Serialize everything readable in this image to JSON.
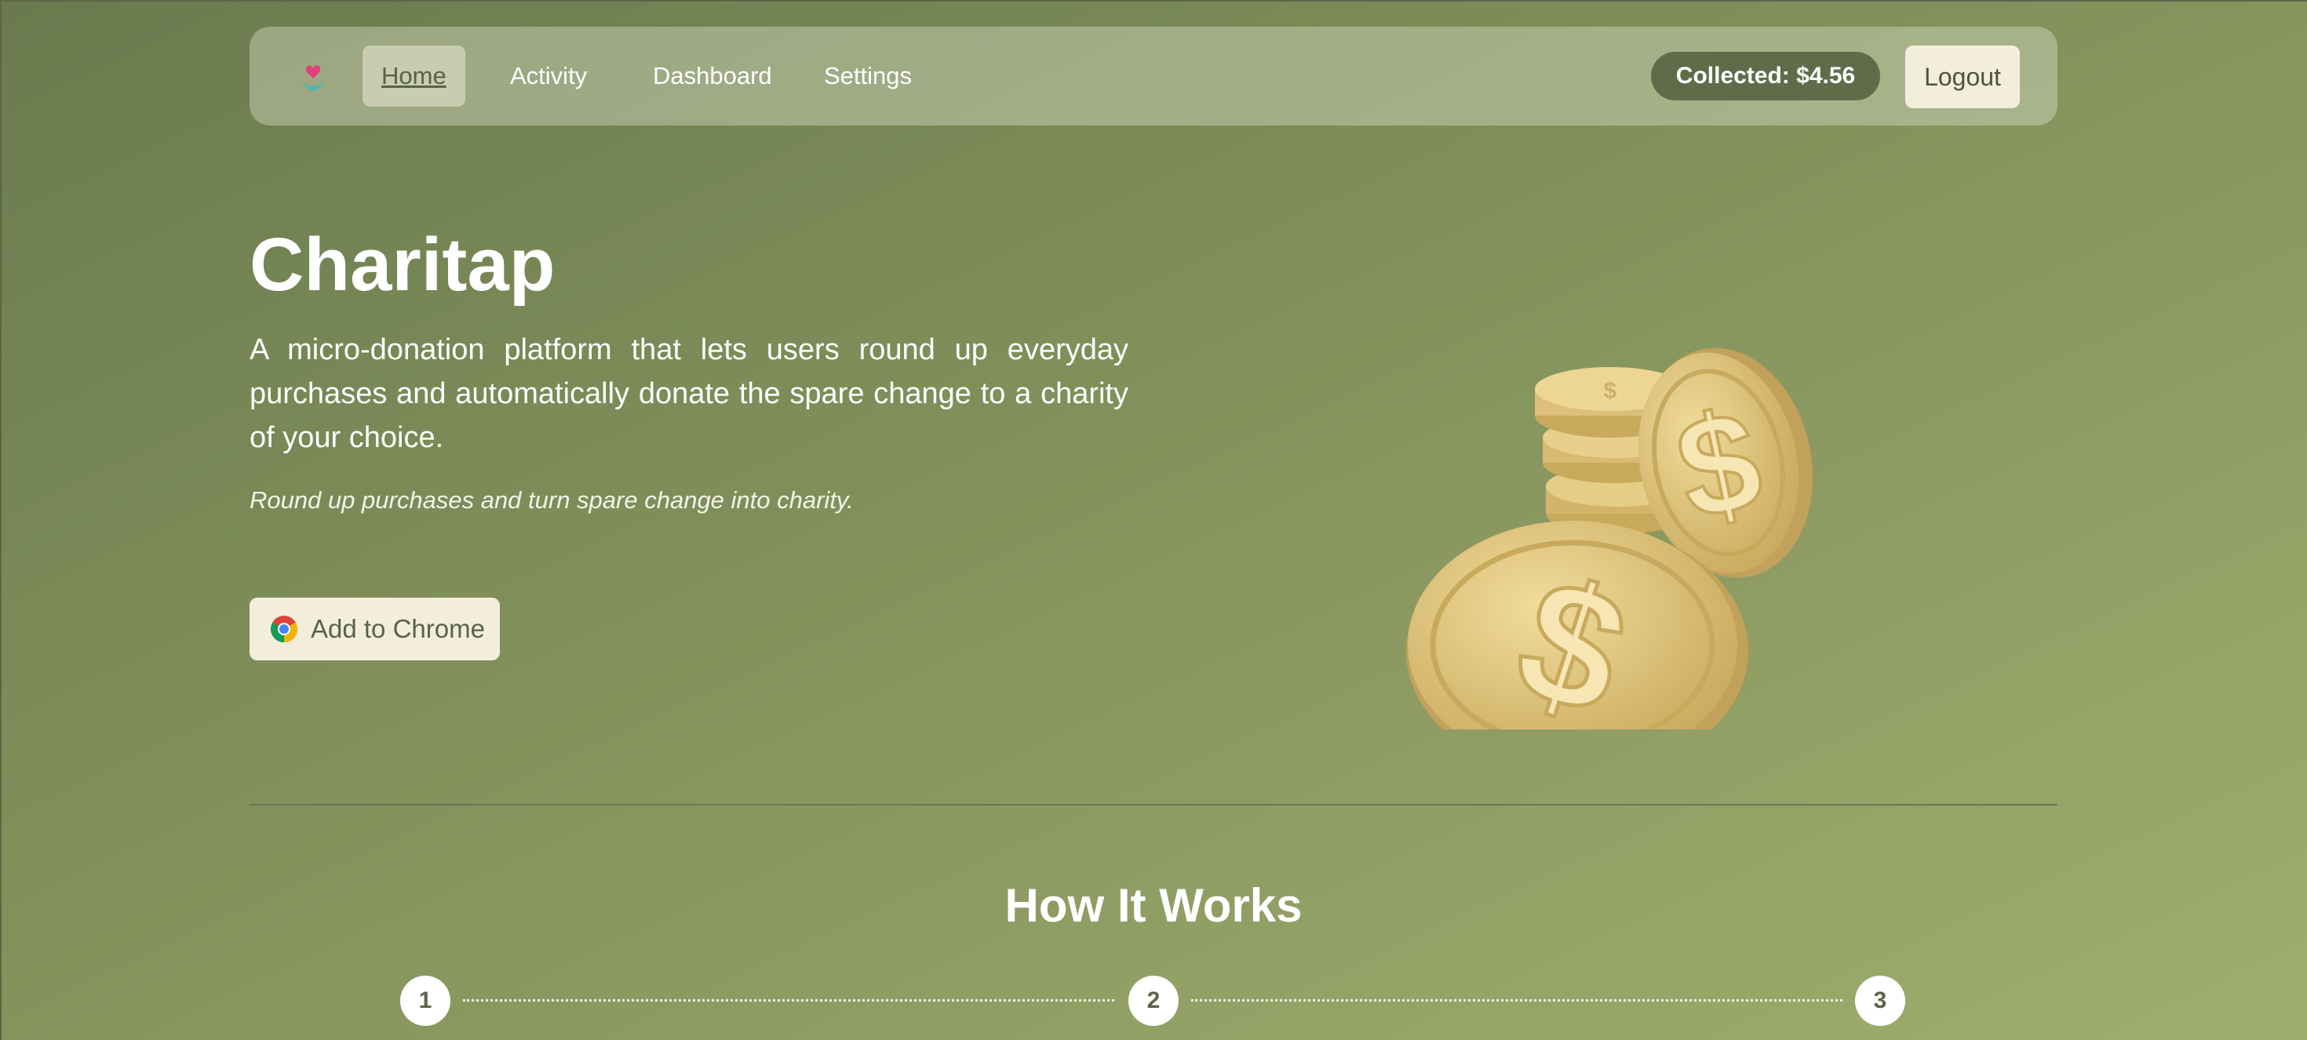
{
  "nav": {
    "logo_icon": "heart-hands-icon",
    "links": [
      {
        "label": "Home",
        "active": true
      },
      {
        "label": "Activity",
        "active": false
      },
      {
        "label": "Dashboard",
        "active": false
      },
      {
        "label": "Settings",
        "active": false
      }
    ],
    "collected_label": "Collected: $4.56",
    "logout_label": "Logout"
  },
  "hero": {
    "title": "Charitap",
    "description": "A micro-donation platform that lets users round up everyday purchases and automatically donate the spare change to a charity of your choice.",
    "tagline": "Round up purchases and turn spare change into charity.",
    "cta_label": "Add to Chrome",
    "cta_icon": "chrome-icon",
    "illustration": "gold-dollar-coins"
  },
  "how_it_works": {
    "title": "How It Works",
    "steps": [
      "1",
      "2",
      "3"
    ]
  },
  "colors": {
    "accent": "#f3eedc",
    "badge": "#606c49",
    "text_dark": "#586446"
  }
}
